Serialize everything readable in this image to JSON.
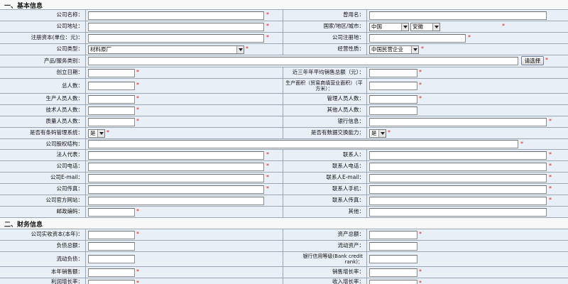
{
  "sections": {
    "basic": "一、基本信息",
    "finance": "二、财务信息"
  },
  "star": "*",
  "basic": {
    "company_name": "公司名称：",
    "former_name": "曾用名：",
    "company_address": "公司地址：",
    "country_region_city": "国家/地区/城市：",
    "country_value": "中国",
    "province_value": "安徽",
    "registered_capital": "注册资本(单位：元)：",
    "registered_place": "公司注册地：",
    "company_type": "公司类型：",
    "company_type_value": "材料原厂",
    "business_nature": "经营性质：",
    "business_nature_value": "中国民营企业",
    "product_category": "产品/服务类别：",
    "select_button": "请选择",
    "founded_date": "创立日期：",
    "sales_3y": "近三年年平均销售总额（元）：",
    "total_staff": "总人数：",
    "production_area": "生产面积（贸易商填营业面积）（平方米）：",
    "production_staff": "生产人员人数：",
    "management_staff": "管理人员人数：",
    "tech_staff": "技术人员人数：",
    "other_staff": "其他人员人数：",
    "quality_staff": "质量人员人数：",
    "bank_info": "银行信息：",
    "barcode_system": "是否有条码管理系统：",
    "barcode_value": "是",
    "data_exchange": "是否有数据交换能力：",
    "data_exchange_value": "是",
    "equity_structure": "公司股权结构：",
    "legal_rep": "法人代表：",
    "contact": "联系人：",
    "company_phone": "公司电话：",
    "contact_phone": "联系人电话：",
    "company_email": "公司E-mail：",
    "contact_email": "联系人E-mail：",
    "company_fax": "公司传真：",
    "contact_mobile": "联系人手机：",
    "company_website": "公司官方网站：",
    "contact_fax": "联系人传真：",
    "postal_code": "邮政编码：",
    "other": "其他："
  },
  "finance": {
    "paid_capital": "公司实收资本(本年)：",
    "total_assets": "资产总额：",
    "total_liabilities": "负债总额：",
    "current_assets": "流动资产：",
    "current_liabilities": "流动负债：",
    "bank_credit_rank": "银行信用等级(Bank credit rank)：",
    "annual_sales": "本年销售额：",
    "sales_growth": "销售增长率：",
    "profit_growth": "利润增长率：",
    "income_growth": "收入增长率："
  }
}
